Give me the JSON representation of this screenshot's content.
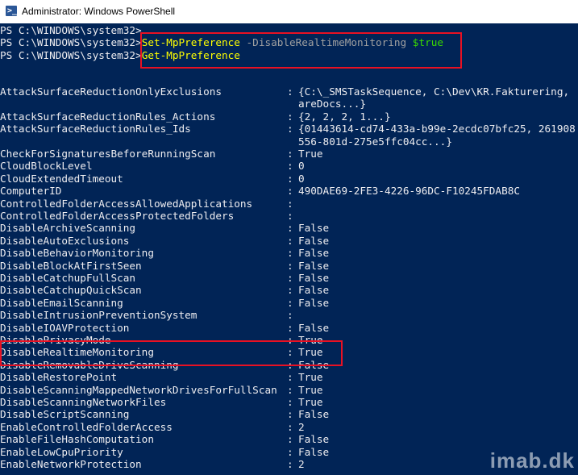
{
  "window": {
    "title": "Administrator: Windows PowerShell",
    "icon": "powershell-icon"
  },
  "prompt": "PS C:\\WINDOWS\\system32>",
  "command1": {
    "cmdlet": "Set-MpPreference",
    "param": "-DisableRealtimeMonitoring",
    "value": "$true"
  },
  "command2": {
    "cmdlet": "Get-MpPreference"
  },
  "rows": [
    {
      "name": "AttackSurfaceReductionOnlyExclusions",
      "value": "{C:\\_SMSTaskSequence, C:\\Dev\\KR.Fakturering,",
      "cont": "areDocs...}"
    },
    {
      "name": "AttackSurfaceReductionRules_Actions",
      "value": "{2, 2, 2, 1...}"
    },
    {
      "name": "AttackSurfaceReductionRules_Ids",
      "value": "{01443614-cd74-433a-b99e-2ecdc07bfc25, 261908",
      "cont": "556-801d-275e5ffc04cc...}"
    },
    {
      "name": "CheckForSignaturesBeforeRunningScan",
      "value": "True"
    },
    {
      "name": "CloudBlockLevel",
      "value": "0"
    },
    {
      "name": "CloudExtendedTimeout",
      "value": "0"
    },
    {
      "name": "ComputerID",
      "value": "490DAE69-2FE3-4226-96DC-F10245FDAB8C"
    },
    {
      "name": "ControlledFolderAccessAllowedApplications",
      "value": ""
    },
    {
      "name": "ControlledFolderAccessProtectedFolders",
      "value": ""
    },
    {
      "name": "DisableArchiveScanning",
      "value": "False"
    },
    {
      "name": "DisableAutoExclusions",
      "value": "False"
    },
    {
      "name": "DisableBehaviorMonitoring",
      "value": "False"
    },
    {
      "name": "DisableBlockAtFirstSeen",
      "value": "False"
    },
    {
      "name": "DisableCatchupFullScan",
      "value": "False"
    },
    {
      "name": "DisableCatchupQuickScan",
      "value": "False"
    },
    {
      "name": "DisableEmailScanning",
      "value": "False"
    },
    {
      "name": "DisableIntrusionPreventionSystem",
      "value": ""
    },
    {
      "name": "DisableIOAVProtection",
      "value": "False"
    },
    {
      "name": "DisablePrivacyMode",
      "value": "True"
    },
    {
      "name": "DisableRealtimeMonitoring",
      "value": "True"
    },
    {
      "name": "DisableRemovableDriveScanning",
      "value": "False"
    },
    {
      "name": "DisableRestorePoint",
      "value": "True"
    },
    {
      "name": "DisableScanningMappedNetworkDrivesForFullScan",
      "value": "True"
    },
    {
      "name": "DisableScanningNetworkFiles",
      "value": "True"
    },
    {
      "name": "DisableScriptScanning",
      "value": "False"
    },
    {
      "name": "EnableControlledFolderAccess",
      "value": "2"
    },
    {
      "name": "EnableFileHashComputation",
      "value": "False"
    },
    {
      "name": "EnableLowCpuPriority",
      "value": "False"
    },
    {
      "name": "EnableNetworkProtection",
      "value": "2"
    }
  ],
  "watermark": "imab.dk"
}
